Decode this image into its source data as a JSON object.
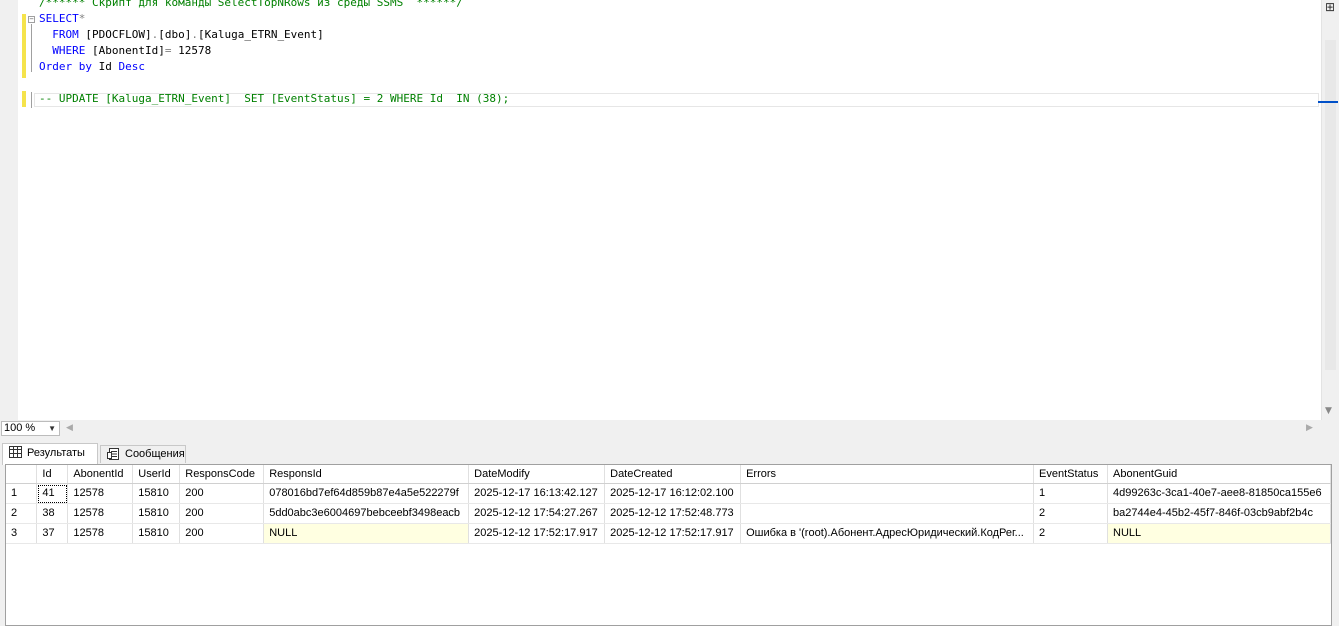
{
  "editor": {
    "lines": [
      [
        {
          "t": "/****** Скрипт для команды SelectTopNRows из среды SSMS  ******/",
          "c": "cm"
        }
      ],
      [
        {
          "t": "SELECT",
          "c": "kw"
        },
        {
          "t": "*",
          "c": "op"
        }
      ],
      [
        {
          "t": "  FROM ",
          "c": "kw"
        },
        {
          "t": "[PDOCFLOW]",
          "c": "str"
        },
        {
          "t": ".",
          "c": "op"
        },
        {
          "t": "[dbo]",
          "c": "str"
        },
        {
          "t": ".",
          "c": "op"
        },
        {
          "t": "[Kaluga_ETRN_Event]",
          "c": "str"
        }
      ],
      [
        {
          "t": "  WHERE ",
          "c": "kw"
        },
        {
          "t": "[AbonentId]",
          "c": "str"
        },
        {
          "t": "=",
          "c": "op"
        },
        {
          "t": " 12578",
          "c": "str"
        }
      ],
      [
        {
          "t": "Order by ",
          "c": "kw"
        },
        {
          "t": "Id ",
          "c": "str"
        },
        {
          "t": "Desc",
          "c": "kw"
        }
      ],
      [
        {
          "t": "",
          "c": "str"
        }
      ],
      [
        {
          "t": "-- UPDATE [Kaluga_ETRN_Event]  SET [EventStatus] = 2 WHERE Id  IN (38);",
          "c": "cm"
        }
      ]
    ]
  },
  "zoom": {
    "value": "100 %"
  },
  "tabs": {
    "results": "Результаты",
    "messages": "Сообщения"
  },
  "grid": {
    "columns": [
      "",
      "Id",
      "AbonentId",
      "UserId",
      "ResponsCode",
      "ResponsId",
      "DateModify",
      "DateCreated",
      "Errors",
      "EventStatus",
      "AbonentGuid"
    ],
    "rows": [
      [
        "1",
        "41",
        "12578",
        "15810",
        "200",
        "078016bd7ef64d859b87e4a5e522279f",
        "2025-12-17 16:13:42.127",
        "2025-12-17 16:12:02.100",
        "",
        "1",
        "4d99263c-3ca1-40e7-aee8-81850ca155e6"
      ],
      [
        "2",
        "38",
        "12578",
        "15810",
        "200",
        "5dd0abc3e6004697bebceebf3498eacb",
        "2025-12-12 17:54:27.267",
        "2025-12-12 17:52:48.773",
        "",
        "2",
        "ba2744e4-45b2-45f7-846f-03cb9abf2b4c"
      ],
      [
        "3",
        "37",
        "12578",
        "15810",
        "200",
        "NULL",
        "2025-12-12 17:52:17.917",
        "2025-12-12 17:52:17.917",
        "Ошибка в '(root).Абонент.АдресЮридический.КодРег...",
        "2",
        "NULL"
      ]
    ]
  },
  "colors": {
    "keyword": "#0000ff",
    "comment": "#008000",
    "null_cell": "#ffffe1"
  }
}
